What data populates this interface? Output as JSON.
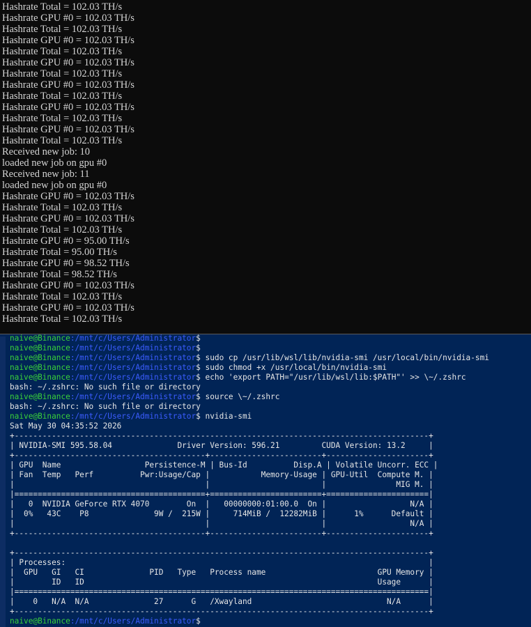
{
  "top_terminal": {
    "lines": [
      "Hashrate Total = 102.03 TH/s",
      "Hashrate GPU #0 = 102.03 TH/s",
      "Hashrate Total = 102.03 TH/s",
      "Hashrate GPU #0 = 102.03 TH/s",
      "Hashrate Total = 102.03 TH/s",
      "Hashrate GPU #0 = 102.03 TH/s",
      "Hashrate Total = 102.03 TH/s",
      "Hashrate GPU #0 = 102.03 TH/s",
      "Hashrate Total = 102.03 TH/s",
      "Hashrate GPU #0 = 102.03 TH/s",
      "Hashrate Total = 102.03 TH/s",
      "Hashrate GPU #0 = 102.03 TH/s",
      "Hashrate Total = 102.03 TH/s",
      "Received new job: 10",
      "loaded new job on gpu #0",
      "Received new job: 11",
      "loaded new job on gpu #0",
      "Hashrate GPU #0 = 102.03 TH/s",
      "Hashrate Total = 102.03 TH/s",
      "Hashrate GPU #0 = 102.03 TH/s",
      "Hashrate Total = 102.03 TH/s",
      "Hashrate GPU #0 = 95.00 TH/s",
      "Hashrate Total = 95.00 TH/s",
      "Hashrate GPU #0 = 98.52 TH/s",
      "Hashrate Total = 98.52 TH/s",
      "Hashrate GPU #0 = 102.03 TH/s",
      "Hashrate Total = 102.03 TH/s",
      "Hashrate GPU #0 = 102.03 TH/s",
      "Hashrate Total = 102.03 TH/s"
    ]
  },
  "bottom_terminal": {
    "prompt_user": "naive@Binance",
    "prompt_path": ":/mnt/c/Users/Administrator",
    "prompt_symbol": "$",
    "colors": {
      "user": "#3ad13a",
      "path": "#3b5cff",
      "text": "#e6e6e6",
      "background": "#012456"
    },
    "lines": [
      {
        "kind": "prompt",
        "cmd": ""
      },
      {
        "kind": "prompt",
        "cmd": ""
      },
      {
        "kind": "prompt",
        "cmd": " sudo cp /usr/lib/wsl/lib/nvidia-smi /usr/local/bin/nvidia-smi"
      },
      {
        "kind": "prompt",
        "cmd": " sudo chmod +x /usr/local/bin/nvidia-smi"
      },
      {
        "kind": "prompt",
        "cmd": " echo 'export PATH=\"/usr/lib/wsl/lib:$PATH\"' >> \\~/.zshrc"
      },
      {
        "kind": "out",
        "text": "bash: ~/.zshrc: No such file or directory"
      },
      {
        "kind": "prompt",
        "cmd": " source \\~/.zshrc"
      },
      {
        "kind": "out",
        "text": "bash: ~/.zshrc: No such file or directory"
      },
      {
        "kind": "prompt",
        "cmd": " nvidia-smi"
      },
      {
        "kind": "out",
        "text": "Sat May 30 04:35:52 2026"
      },
      {
        "kind": "out",
        "text": "+-----------------------------------------------------------------------------------------+"
      },
      {
        "kind": "out",
        "text": "| NVIDIA-SMI 595.58.04              Driver Version: 596.21         CUDA Version: 13.2     |"
      },
      {
        "kind": "out",
        "text": "+-----------------------------------------+------------------------+----------------------+"
      },
      {
        "kind": "out",
        "text": "| GPU  Name                  Persistence-M | Bus-Id          Disp.A | Volatile Uncorr. ECC |"
      },
      {
        "kind": "out",
        "text": "| Fan  Temp   Perf          Pwr:Usage/Cap |           Memory-Usage | GPU-Util  Compute M. |"
      },
      {
        "kind": "out",
        "text": "|                                         |                        |               MIG M. |"
      },
      {
        "kind": "out",
        "text": "|=========================================+========================+======================|"
      },
      {
        "kind": "out",
        "text": "|   0  NVIDIA GeForce RTX 4070        On  |   00000000:01:00.0  On |                  N/A |"
      },
      {
        "kind": "out",
        "text": "|  0%   43C    P8              9W /  215W |     714MiB /  12282MiB |      1%      Default |"
      },
      {
        "kind": "out",
        "text": "|                                         |                        |                  N/A |"
      },
      {
        "kind": "out",
        "text": "+-----------------------------------------+------------------------+----------------------+"
      },
      {
        "kind": "out",
        "text": ""
      },
      {
        "kind": "out",
        "text": "+-----------------------------------------------------------------------------------------+"
      },
      {
        "kind": "out",
        "text": "| Processes:                                                                              |"
      },
      {
        "kind": "out",
        "text": "|  GPU   GI   CI              PID   Type   Process name                        GPU Memory |"
      },
      {
        "kind": "out",
        "text": "|        ID   ID                                                               Usage      |"
      },
      {
        "kind": "out",
        "text": "|=========================================================================================|"
      },
      {
        "kind": "out",
        "text": "|    0   N/A  N/A              27      G   /Xwayland                             N/A      |"
      },
      {
        "kind": "out",
        "text": "+-----------------------------------------------------------------------------------------+"
      },
      {
        "kind": "prompt",
        "cmd": ""
      }
    ]
  }
}
